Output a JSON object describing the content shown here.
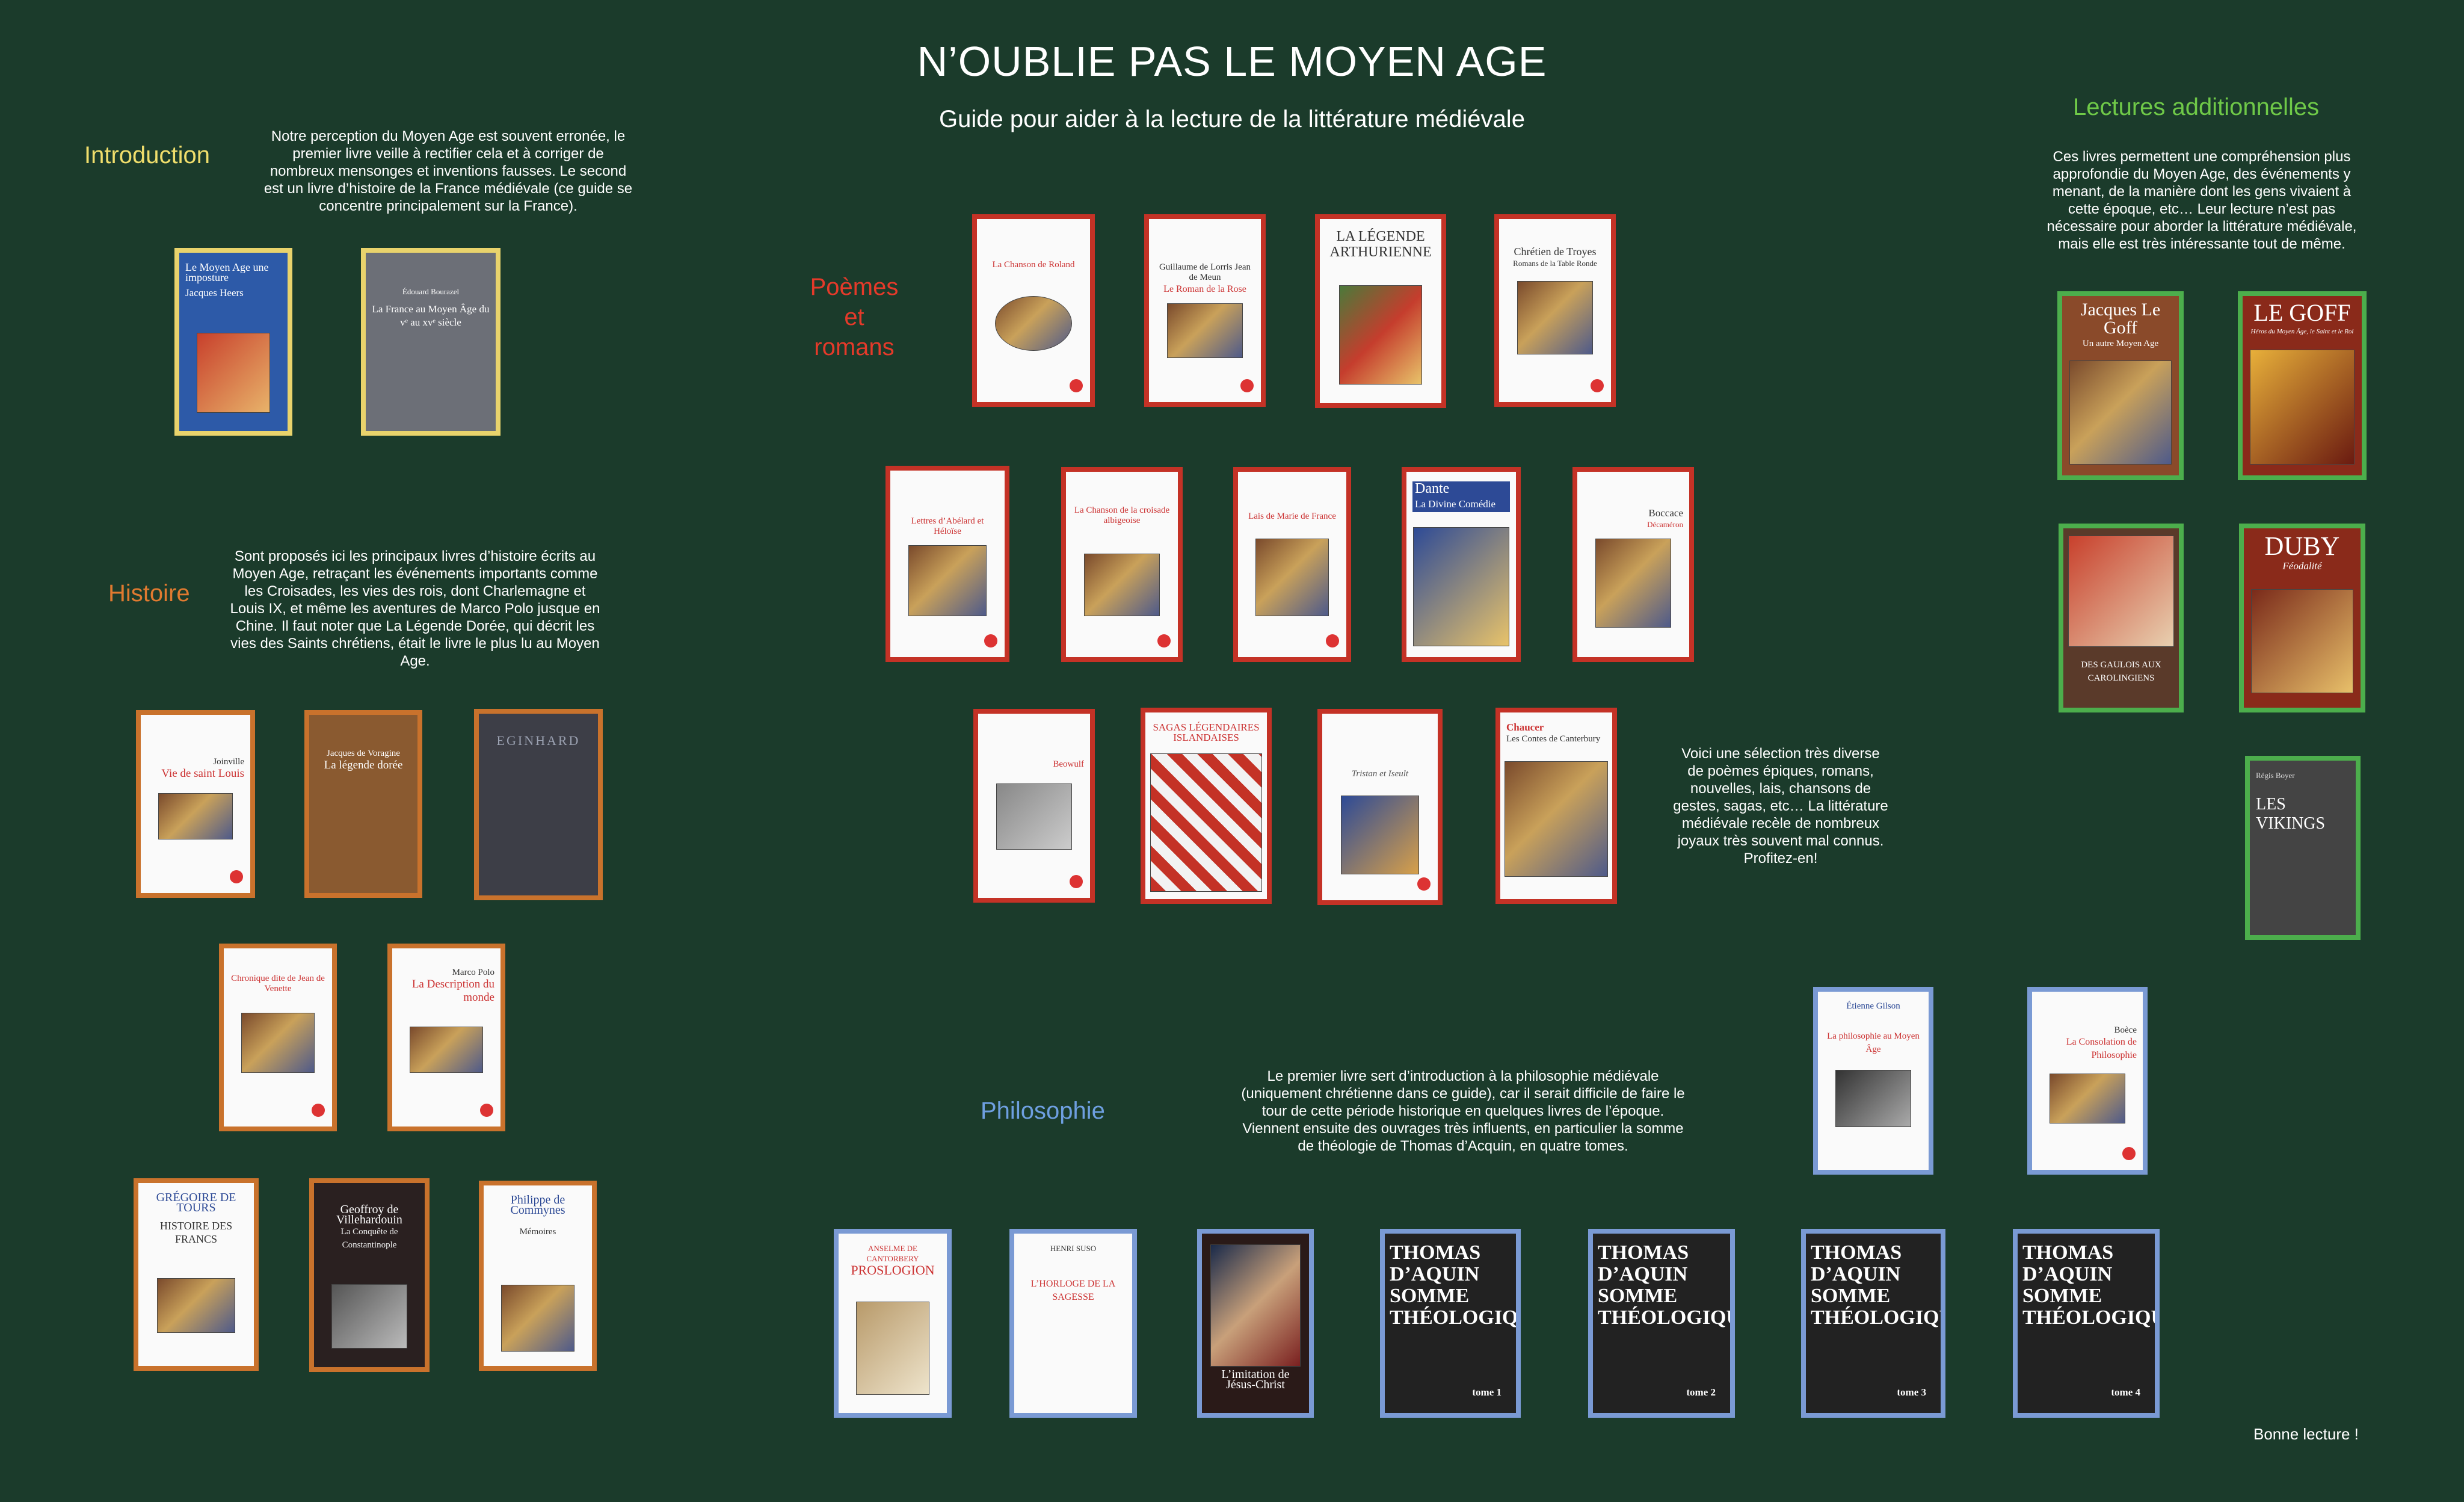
{
  "header": {
    "title": "N’OUBLIE PAS LE MOYEN AGE",
    "subtitle": "Guide pour aider à la lecture de la littérature médiévale"
  },
  "colors": {
    "background": "#1b3b2b",
    "introduction": "#f0de6c",
    "histoire": "#e07a30",
    "poemes": "#e53a2a",
    "philosophie": "#6e9fe0",
    "lectures": "#6fc948"
  },
  "sections": {
    "introduction": {
      "label": "Introduction",
      "text": "Notre perception du Moyen Age est souvent erronée, le premier livre veille à rectifier cela et à corriger de nombreux mensonges et inventions fausses. Le second est un livre d’histoire de la France médiévale (ce guide se concentre principalement sur la France)."
    },
    "histoire": {
      "label": "Histoire",
      "text": "Sont proposés ici les principaux livres d’histoire écrits au Moyen Age, retraçant les événements importants comme les Croisades, les vies des rois, dont Charlemagne et Louis IX, et même les aventures de Marco Polo jusque en Chine. Il faut noter que La Légende Dorée, qui décrit les vies des Saints chrétiens, était le livre le plus lu au Moyen Age."
    },
    "poemes": {
      "label_lines": [
        "Poèmes",
        "et",
        "romans"
      ],
      "text": "Voici une sélection très diverse de poèmes épiques, romans, nouvelles, lais, chansons de gestes, sagas, etc… La littérature médiévale recèle de nombreux joyaux très souvent mal connus. Profitez-en!"
    },
    "philosophie": {
      "label": "Philosophie",
      "text": "Le premier livre sert d’introduction à la philosophie médiévale (uniquement chrétienne dans ce guide), car il serait difficile de faire le tour de cette période historique en quelques livres de l’époque. Viennent ensuite des ouvrages très influents, en particulier la somme de théologie de Thomas d’Acquin, en quatre tomes."
    },
    "lectures": {
      "label": "Lectures additionnelles",
      "text": "Ces livres permettent une compréhension plus approfondie du Moyen Age, des événements y menant, de la manière dont les gens vivaient à cette époque, etc… Leur lecture n’est pas nécessaire pour aborder la littérature médiévale, mais elle est très intéressante tout de même."
    }
  },
  "books": {
    "intro": [
      {
        "t1": "Le Moyen Age une imposture",
        "t2": "Jacques Heers"
      },
      {
        "t1": "Édouard Bourazel",
        "t2": "La France au Moyen Âge du vᵉ au xvᵉ siècle"
      }
    ],
    "histoire": [
      {
        "t1": "Joinville",
        "t2": "Vie de saint Louis"
      },
      {
        "t1": "Jacques de Voragine",
        "t2": "La légende dorée"
      },
      {
        "t1": "EGINHARD",
        "t2": ""
      },
      {
        "t1": "Chronique dite de Jean de Venette",
        "t2": ""
      },
      {
        "t1": "Marco Polo",
        "t2": "La Description du monde"
      },
      {
        "t1": "GRÉGOIRE DE TOURS",
        "t2": "HISTOIRE DES FRANCS"
      },
      {
        "t1": "Geoffroy de Villehardouin",
        "t2": "La Conquête de Constantinople"
      },
      {
        "t1": "Philippe de Commynes",
        "t2": "Mémoires"
      }
    ],
    "poemes": [
      {
        "t1": "La Chanson de Roland",
        "t2": ""
      },
      {
        "t1": "Guillaume de Lorris Jean de Meun",
        "t2": "Le Roman de la Rose"
      },
      {
        "t1": "LA LÉGENDE ARTHURIENNE",
        "t2": ""
      },
      {
        "t1": "Chrétien de Troyes",
        "t2": "Romans de la Table Ronde"
      },
      {
        "t1": "Lettres d’Abélard et Héloïse",
        "t2": ""
      },
      {
        "t1": "La Chanson de la croisade albigeoise",
        "t2": ""
      },
      {
        "t1": "Lais de Marie de France",
        "t2": ""
      },
      {
        "t1": "Dante",
        "t2": "La Divine Comédie"
      },
      {
        "t1": "Boccace",
        "t2": "Décaméron"
      },
      {
        "t1": "Beowulf",
        "t2": ""
      },
      {
        "t1": "SAGAS LÉGENDAIRES ISLANDAISES",
        "t2": ""
      },
      {
        "t1": "Tristan et Iseult",
        "t2": ""
      },
      {
        "t1": "Chaucer",
        "t2": "Les Contes de Canterbury"
      }
    ],
    "philosophie": [
      {
        "t1": "Étienne Gilson",
        "t2": "La philosophie au Moyen Âge"
      },
      {
        "t1": "Boèce",
        "t2": "La Consolation de Philosophie"
      },
      {
        "t1": "ANSELME DE CANTORBERY",
        "t2": "PROSLOGION"
      },
      {
        "t1": "HENRI SUSO",
        "t2": "L’HORLOGE DE LA SAGESSE"
      },
      {
        "t1": "L’imitation de Jésus-Christ",
        "t2": ""
      }
    ],
    "thomas": {
      "title": "THOMAS D’AQUIN SOMME THÉOLOGIQUE",
      "tomes": [
        "tome 1",
        "tome 2",
        "tome 3",
        "tome 4"
      ]
    },
    "lectures": [
      {
        "t1": "Jacques Le Goff",
        "t2": "Un autre Moyen Age"
      },
      {
        "t1": "LE GOFF",
        "t2": "Héros du Moyen Âge, le Saint et le Roi"
      },
      {
        "t1": "",
        "t2": "DES GAULOIS AUX CAROLINGIENS"
      },
      {
        "t1": "DUBY",
        "t2": "Féodalité"
      },
      {
        "t1": "Régis Boyer",
        "t2": "LES VIKINGS"
      }
    ]
  },
  "footer": {
    "text": "Bonne lecture !"
  }
}
